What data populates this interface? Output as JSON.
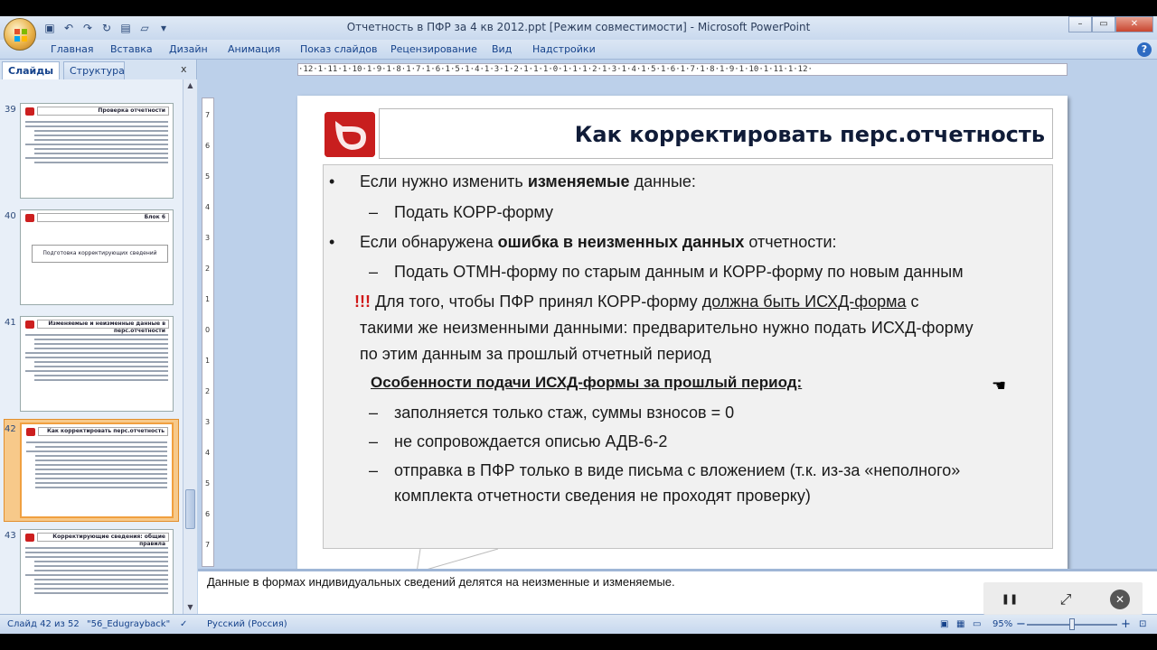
{
  "window": {
    "title": "Отчетность в ПФР за 4 кв 2012.ppt [Режим совместимости] - Microsoft PowerPoint",
    "qat_icons": [
      "save-icon",
      "undo-icon",
      "redo-icon",
      "refresh-icon",
      "new-icon",
      "open-icon"
    ],
    "controls": [
      "–",
      "▭",
      "✕"
    ]
  },
  "ribbon": {
    "tabs": [
      "Главная",
      "Вставка",
      "Дизайн",
      "Анимация",
      "Показ слайдов",
      "Рецензирование",
      "Вид",
      "Надстройки"
    ],
    "help": "?"
  },
  "left_panel": {
    "tab_slides": "Слайды",
    "tab_outline": "Структура",
    "close": "x",
    "thumbnails": [
      {
        "num": "39",
        "title": "Проверка отчетности",
        "selected": false
      },
      {
        "num": "40",
        "title": "Блок 6",
        "boxed": "Подготовка корректирующих сведений",
        "selected": false
      },
      {
        "num": "41",
        "title": "Изменяемые и неизменные данные в перс.отчетности",
        "selected": false
      },
      {
        "num": "42",
        "title": "Как корректировать перс.отчетность",
        "selected": true
      },
      {
        "num": "43",
        "title": "Корректирующие сведения: общие правила",
        "selected": false
      }
    ]
  },
  "ruler": {
    "h_text": "·12·1·11·1·10·1·9·1·8·1·7·1·6·1·5·1·4·1·3·1·2·1·1·1·0·1·1·1·2·1·3·1·4·1·5·1·6·1·7·1·8·1·9·1·10·1·11·1·12·",
    "v_ticks": [
      "7",
      "6",
      "5",
      "4",
      "3",
      "2",
      "1",
      "0",
      "1",
      "2",
      "3",
      "4",
      "5",
      "6",
      "7"
    ]
  },
  "slide": {
    "title": "Как корректировать перс.отчетность",
    "bullet1_a": "Если нужно изменить ",
    "bullet1_b": "изменяемые",
    "bullet1_c": " данные:",
    "sub1": "Подать КОРР-форму",
    "bullet2_a": "Если обнаружена ",
    "bullet2_b": "ошибка в неизменных данных",
    "bullet2_c": " отчетности:",
    "sub2": "Подать ОТМН-форму по старым данным и КОРР-форму по новым данным",
    "warn_mark": "!!!",
    "warn_a": " Для того, чтобы ПФР принял КОРР-форму ",
    "warn_b": "должна быть ИСХД-форма",
    "warn_c": " с",
    "warn_line2": "такими же неизменными данными: предварительно нужно подать ИСХД-форму",
    "warn_line3": "по этим данным за прошлый отчетный период",
    "features_heading": "Особенности подачи ИСХД-формы за прошлый период:",
    "feat1": "заполняется только стаж, суммы взносов = 0",
    "feat2": "не сопровождается описью АДВ-6-2",
    "feat3_l1": "отправка в ПФР только в виде письма с вложением (т.к. из-за «неполного»",
    "feat3_l2": "комплекта отчетности  сведения не проходят проверку)",
    "bullet_char": "•",
    "dash_char": "–"
  },
  "notes": {
    "text": "Данные в формах индивидуальных сведений делятся на неизменные и изменяемые."
  },
  "statusbar": {
    "slide_info": "Слайд 42 из 52",
    "theme": "\"56_Edugrayback\"",
    "language": "Русский (Россия)",
    "zoom": "95%",
    "zoom_minus": "−",
    "zoom_plus": "+"
  },
  "player": {
    "pause": "❚❚",
    "fullscreen": "⤢",
    "close": "✕"
  },
  "colors": {
    "title_text": "#101c38",
    "logo_red": "#c81e1e",
    "warning_red": "#d01818",
    "selection_orange": "#f7c98a"
  }
}
